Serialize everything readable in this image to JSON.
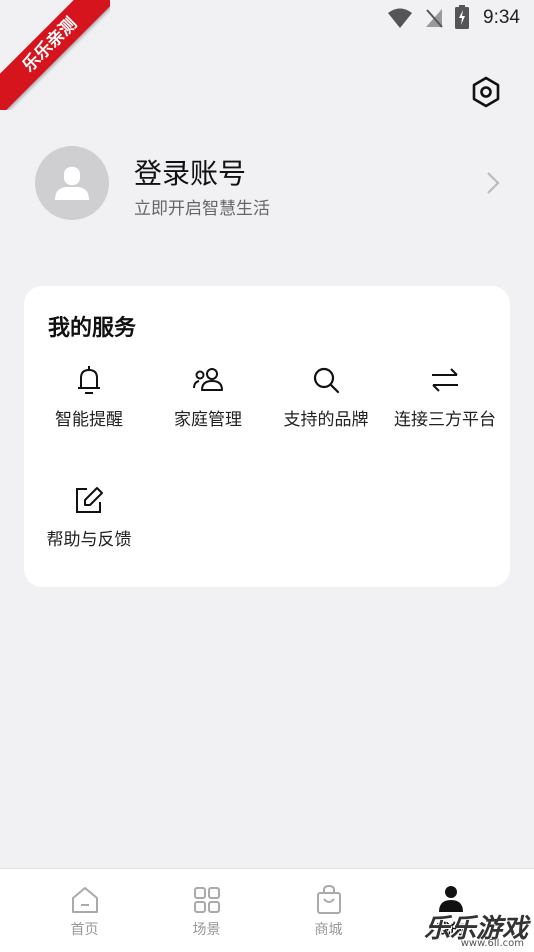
{
  "status_bar": {
    "time": "9:34"
  },
  "ribbon": {
    "text": "乐乐亲测"
  },
  "profile": {
    "title": "登录账号",
    "subtitle": "立即开启智慧生活"
  },
  "services": {
    "title": "我的服务",
    "items": [
      {
        "label": "智能提醒",
        "icon": "bell-icon"
      },
      {
        "label": "家庭管理",
        "icon": "family-icon"
      },
      {
        "label": "支持的品牌",
        "icon": "search-icon"
      },
      {
        "label": "连接三方平台",
        "icon": "swap-icon"
      },
      {
        "label": "帮助与反馈",
        "icon": "edit-icon"
      }
    ]
  },
  "nav": {
    "items": [
      {
        "label": "首页",
        "icon": "home-icon"
      },
      {
        "label": "场景",
        "icon": "grid-icon"
      },
      {
        "label": "商城",
        "icon": "shopping-bag-icon"
      },
      {
        "label": "我的",
        "icon": "person-icon"
      }
    ],
    "active_index": 3
  },
  "watermark": {
    "text": "乐乐游戏",
    "url": "www.6ll.com"
  },
  "colors": {
    "background": "#f1f0f3",
    "card": "#ffffff",
    "ribbon": "#d6141d"
  }
}
